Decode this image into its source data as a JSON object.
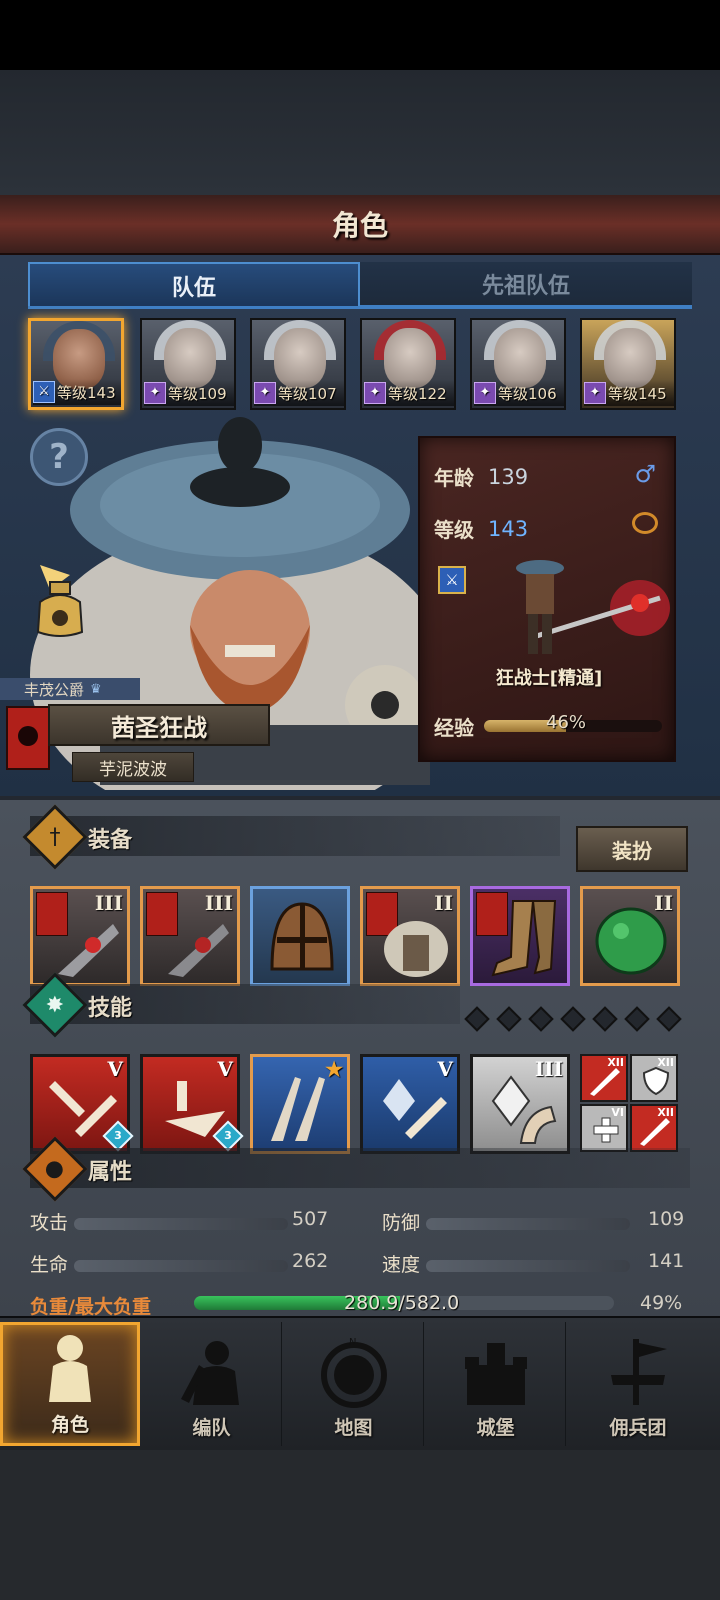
{
  "header": {
    "title": "角色"
  },
  "tabs": [
    {
      "label": "队伍",
      "active": true
    },
    {
      "label": "先祖队伍",
      "active": false
    }
  ],
  "party": [
    {
      "level": "等级143",
      "selected": true,
      "class_icon": "sword-blue"
    },
    {
      "level": "等级109",
      "selected": false,
      "class_icon": "staff-purple"
    },
    {
      "level": "等级107",
      "selected": false,
      "class_icon": "staff-purple"
    },
    {
      "level": "等级122",
      "selected": false,
      "class_icon": "staff-purple"
    },
    {
      "level": "等级106",
      "selected": false,
      "class_icon": "staff-purple"
    },
    {
      "level": "等级145",
      "selected": false,
      "class_icon": "staff-purple"
    }
  ],
  "hero": {
    "title": "丰茂公爵",
    "name": "茜圣狂战",
    "subname": "芋泥波波"
  },
  "info": {
    "age_label": "年龄",
    "age": "139",
    "level_label": "等级",
    "level": "143",
    "gender": "♂",
    "class_name": "狂战士[精通]",
    "exp_label": "经验",
    "exp_pct": "46%",
    "exp_fraction": 0.46
  },
  "equipment": {
    "title": "装备",
    "dress_button": "装扮",
    "slots": [
      {
        "tier": "III",
        "rarity": "orange",
        "flag": true
      },
      {
        "tier": "III",
        "rarity": "orange",
        "flag": true
      },
      {
        "tier": "",
        "rarity": "blue",
        "flag": false
      },
      {
        "tier": "II",
        "rarity": "orange",
        "flag": true
      },
      {
        "tier": "",
        "rarity": "purple",
        "flag": true
      },
      {
        "tier": "II",
        "rarity": "orange",
        "flag": false
      }
    ]
  },
  "skills": {
    "title": "技能",
    "slots": [
      {
        "tier": "V",
        "gem": "3",
        "color": "red"
      },
      {
        "tier": "V",
        "gem": "3",
        "color": "red"
      },
      {
        "tier": "★",
        "gem": "",
        "color": "blue-orange"
      },
      {
        "tier": "V",
        "gem": "",
        "color": "blue"
      },
      {
        "tier": "III",
        "gem": "",
        "color": "grey"
      }
    ],
    "mini": [
      {
        "tier": "XII",
        "color": "red"
      },
      {
        "tier": "XII",
        "color": "grey"
      },
      {
        "tier": "VI",
        "color": "grey"
      },
      {
        "tier": "XII",
        "color": "red"
      }
    ]
  },
  "attributes": {
    "title": "属性",
    "attack_label": "攻击",
    "attack": "507",
    "defense_label": "防御",
    "defense": "109",
    "hp_label": "生命",
    "hp": "262",
    "speed_label": "速度",
    "speed": "141",
    "load_label": "负重/最大负重",
    "load": "280.9/582.0",
    "load_pct": "49%",
    "load_fraction": 0.49
  },
  "nav": [
    {
      "label": "角色",
      "active": true
    },
    {
      "label": "编队",
      "active": false
    },
    {
      "label": "地图",
      "active": false
    },
    {
      "label": "城堡",
      "active": false
    },
    {
      "label": "佣兵团",
      "active": false
    }
  ],
  "colors": {
    "accent_gold": "#f2a630",
    "tab_blue": "#3f7fc4",
    "load_green": "#39c45c",
    "load_label": "#e98a3a"
  }
}
